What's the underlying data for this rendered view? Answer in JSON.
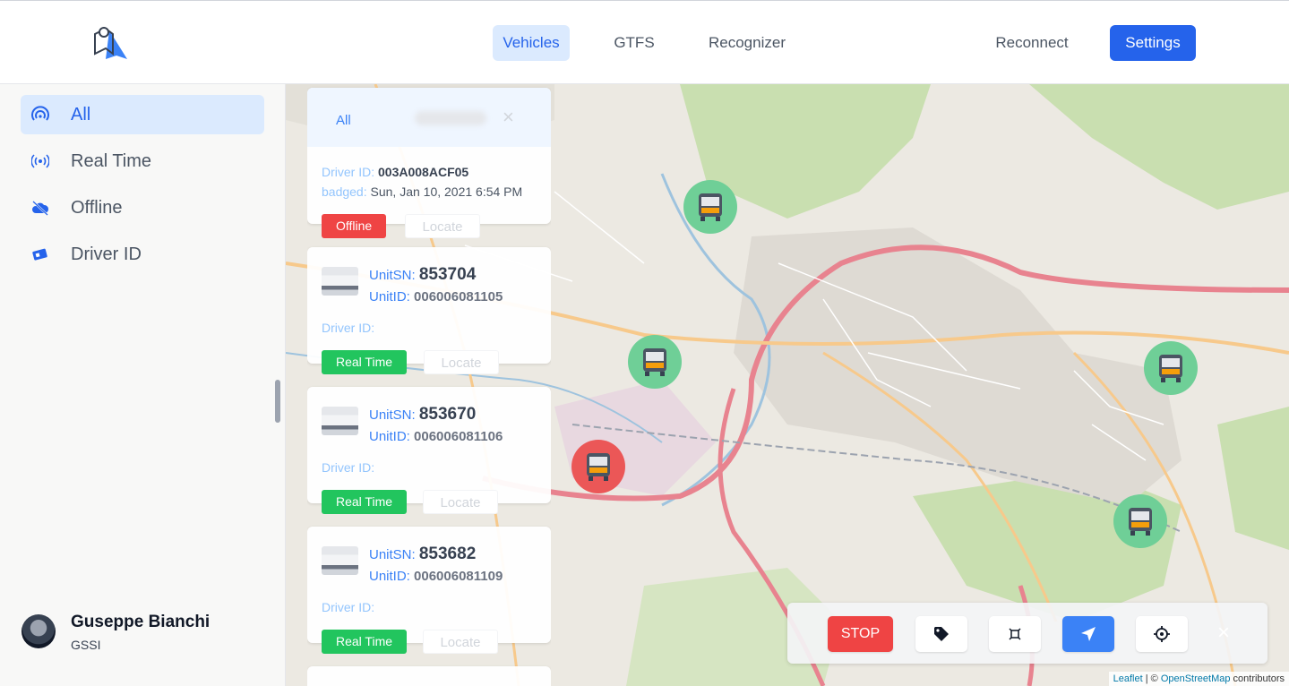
{
  "header": {
    "nav": [
      "Vehicles",
      "GTFS",
      "Recognizer"
    ],
    "reconnect_label": "Reconnect",
    "settings_label": "Settings"
  },
  "sidebar": {
    "items": [
      {
        "label": "All",
        "icon": "all-vehicles-icon",
        "active": true
      },
      {
        "label": "Real Time",
        "icon": "broadcast-icon",
        "active": false
      },
      {
        "label": "Offline",
        "icon": "cloud-off-icon",
        "active": false
      },
      {
        "label": "Driver ID",
        "icon": "id-card-icon",
        "active": false
      }
    ],
    "user": {
      "name": "Guseppe Bianchi",
      "org": "GSSI"
    }
  },
  "vehicle_list": {
    "header_tab": "All",
    "first_card": {
      "driver_label": "Driver ID:",
      "driver_value": "003A008ACF05",
      "badged_label": "badged:",
      "badged_value": "Sun, Jan 10, 2021 6:54 PM",
      "status": "Offline",
      "locate": "Locate"
    },
    "cards": [
      {
        "unitsn_label": "UnitSN:",
        "unitsn": "853704",
        "unitid_label": "UnitID:",
        "unitid": "006006081105",
        "driver_label": "Driver ID:",
        "status": "Real Time",
        "locate": "Locate"
      },
      {
        "unitsn_label": "UnitSN:",
        "unitsn": "853670",
        "unitid_label": "UnitID:",
        "unitid": "006006081106",
        "driver_label": "Driver ID:",
        "status": "Real Time",
        "locate": "Locate"
      },
      {
        "unitsn_label": "UnitSN:",
        "unitsn": "853682",
        "unitid_label": "UnitID:",
        "unitid": "006006081109",
        "driver_label": "Driver ID:",
        "status": "Real Time",
        "locate": "Locate"
      }
    ]
  },
  "toolbar": {
    "stop_label": "STOP",
    "buttons": [
      "tag-icon",
      "selection-icon",
      "navigation-arrow-icon",
      "crosshair-icon"
    ],
    "close": "×"
  },
  "map": {
    "attribution_leaflet": "Leaflet",
    "attribution_sep": " | © ",
    "attribution_osm": "OpenStreetMap",
    "attribution_tail": " contributors",
    "markers": [
      {
        "status": "online",
        "color": "#6fcf97"
      },
      {
        "status": "online",
        "color": "#6fcf97"
      },
      {
        "status": "offline",
        "color": "#eb5757"
      },
      {
        "status": "online",
        "color": "#6fcf97"
      },
      {
        "status": "online",
        "color": "#6fcf97"
      }
    ]
  },
  "colors": {
    "accent": "#2563eb",
    "realtime": "#22c55e",
    "offline": "#ef4444"
  }
}
